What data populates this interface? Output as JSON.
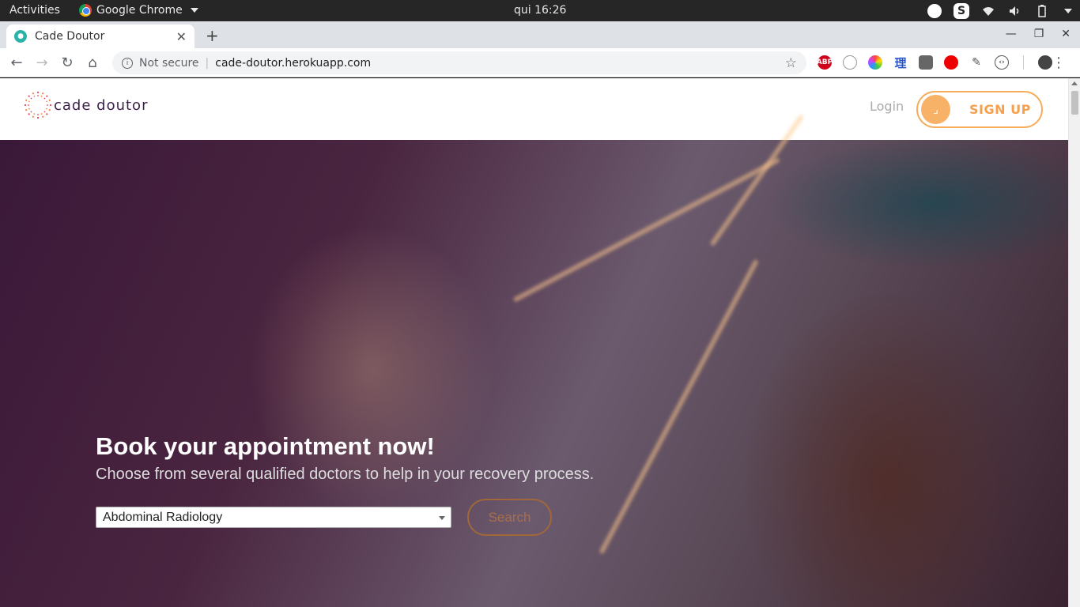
{
  "os_topbar": {
    "activities": "Activities",
    "app_name": "Google Chrome",
    "clock": "qui 16:26"
  },
  "browser": {
    "tab_title": "Cade Doutor",
    "security_label": "Not secure",
    "url": "cade-doutor.herokuapp.com",
    "extensions": [
      "adblock-plus-icon",
      "clock-extension-icon",
      "color-picker-icon",
      "translate-icon",
      "grid-extension-icon",
      "red-extension-icon",
      "tool-extension-icon",
      "code-extension-icon"
    ]
  },
  "site": {
    "logo_text": "cade doutor",
    "login_label": "Login",
    "signup_label": "SIGN UP",
    "accent_color": "#f6ad5b"
  },
  "hero": {
    "title": "Book your appointment now!",
    "subtitle": "Choose from several qualified doctors to help in your recovery process.",
    "specialty_selected": "Abdominal Radiology",
    "search_label": "Search"
  }
}
